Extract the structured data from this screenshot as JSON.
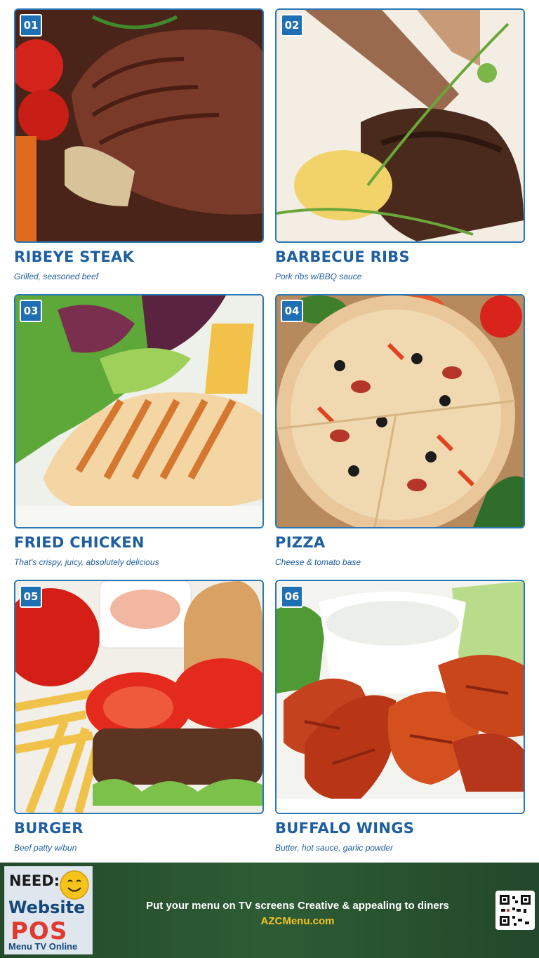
{
  "menu": {
    "items": [
      {
        "number": "01",
        "name": "RIBEYE STEAK",
        "description": "Grilled, seasoned beef",
        "photo_icon": "steak-photo"
      },
      {
        "number": "02",
        "name": "BARBECUE RIBS",
        "description": "Pork ribs w/BBQ sauce",
        "photo_icon": "ribs-photo"
      },
      {
        "number": "03",
        "name": "FRIED CHICKEN",
        "description": "That's crispy, juicy, absolutely delicious",
        "photo_icon": "chicken-photo"
      },
      {
        "number": "04",
        "name": "PIZZA",
        "description": "Cheese & tomato base",
        "photo_icon": "pizza-photo"
      },
      {
        "number": "05",
        "name": "BURGER",
        "description": "Beef patty w/bun",
        "photo_icon": "burger-photo"
      },
      {
        "number": "06",
        "name": "BUFFALO WINGS",
        "description": "Butter, hot sauce, garlic powder",
        "photo_icon": "wings-photo"
      }
    ]
  },
  "footer": {
    "ad": {
      "need": "NEED:",
      "website": "Website",
      "pos": "POS",
      "menu_tv": "Menu TV Online"
    },
    "tagline": "Put your menu on TV screens Creative & appealing to diners",
    "site": "AZCMenu.com",
    "qr_icon": "qr-code-icon"
  },
  "colors": {
    "accent": "#1f5fa0",
    "badge": "#1f6fb4",
    "footer_bg": "#2d5c34",
    "site_link": "#f3c323",
    "pos_red": "#e03a2e"
  }
}
